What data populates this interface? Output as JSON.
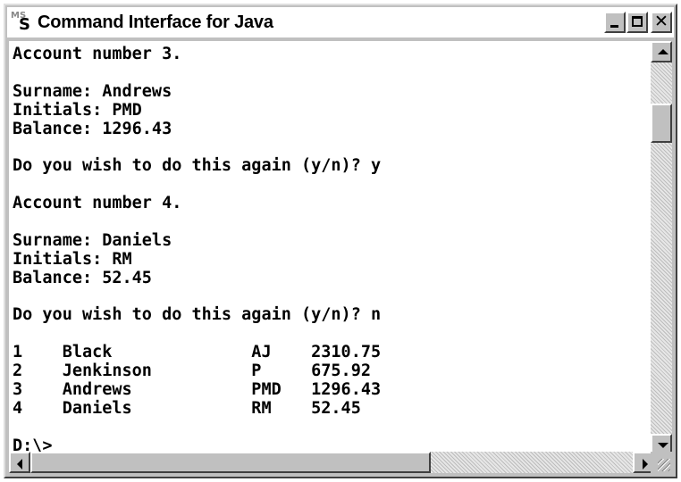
{
  "window": {
    "title": "Command Interface for Java",
    "icon": "ms-dos-icon",
    "controls": {
      "minimize": "minimize-icon",
      "maximize": "maximize-icon",
      "close": "✕"
    }
  },
  "console": {
    "lines": [
      "Account number 3.",
      "",
      "Surname: Andrews",
      "Initials: PMD",
      "Balance: 1296.43",
      "",
      "Do you wish to do this again (y/n)? y",
      "",
      "Account number 4.",
      "",
      "Surname: Daniels",
      "Initials: RM",
      "Balance: 52.45",
      "",
      "Do you wish to do this again (y/n)? n",
      "",
      "1    Black              AJ    2310.75",
      "2    Jenkinson          P     675.92",
      "3    Andrews            PMD   1296.43",
      "4    Daniels            RM    52.45",
      "",
      "D:\\>"
    ]
  }
}
